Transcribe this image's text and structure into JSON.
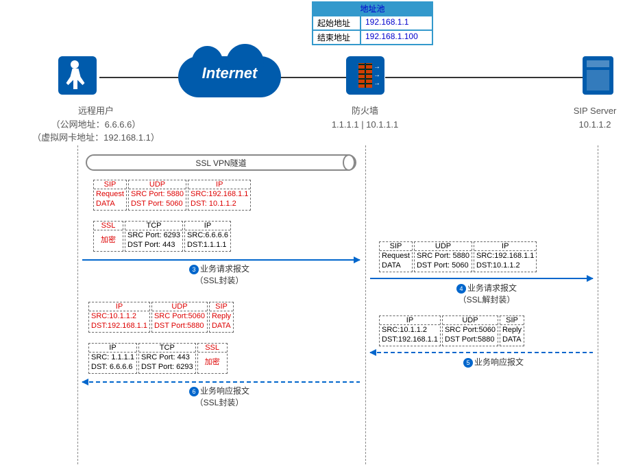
{
  "address_pool": {
    "title": "地址池",
    "start_label": "起始地址",
    "start_value": "192.168.1.1",
    "end_label": "结束地址",
    "end_value": "192.168.1.100"
  },
  "nodes": {
    "remote_user": {
      "label": "远程用户",
      "line2": "（公网地址：6.6.6.6）",
      "line3": "（虚拟网卡地址：192.168.1.1）"
    },
    "internet": {
      "label": "Internet"
    },
    "firewall": {
      "label": "防火墙",
      "addrs": "1.1.1.1 | 10.1.1.1"
    },
    "sip_server": {
      "label": "SIP Server",
      "addr": "10.1.1.2"
    }
  },
  "tunnel": "SSL VPN隧道",
  "packets": {
    "req_inner": {
      "sip_hdr": "SIP",
      "sip_l1": "Request",
      "sip_l2": "DATA",
      "udp_hdr": "UDP",
      "udp_l1": "SRC Port: 5880",
      "udp_l2": "DST Port: 5060",
      "ip_hdr": "IP",
      "ip_l1": "SRC:192.168.1.1",
      "ip_l2": "DST: 10.1.1.2"
    },
    "req_outer": {
      "ssl_hdr": "SSL",
      "ssl_l1": "加密",
      "tcp_hdr": "TCP",
      "tcp_l1": "SRC Port: 6293",
      "tcp_l2": "DST Port:  443",
      "ip_hdr": "IP",
      "ip_l1": "SRC:6.6.6.6",
      "ip_l2": "DST:1.1.1.1"
    },
    "resp_inner": {
      "ip_hdr": "IP",
      "ip_l1": "SRC:10.1.1.2",
      "ip_l2": "DST:192.168.1.1",
      "udp_hdr": "UDP",
      "udp_l1": "SRC Port:5060",
      "udp_l2": "DST Port:5880",
      "sip_hdr": "SIP",
      "sip_l1": "Reply",
      "sip_l2": "DATA"
    },
    "resp_outer": {
      "ip_hdr": "IP",
      "ip_l1": "SRC: 1.1.1.1",
      "ip_l2": "DST:  6.6.6.6",
      "tcp_hdr": "TCP",
      "tcp_l1": "SRC Port:  443",
      "tcp_l2": "DST Port: 6293",
      "ssl_hdr": "SSL",
      "ssl_l1": "加密"
    },
    "right_req": {
      "sip_hdr": "SIP",
      "sip_l1": "Request",
      "sip_l2": "DATA",
      "udp_hdr": "UDP",
      "udp_l1": "SRC Port: 5880",
      "udp_l2": "DST Port: 5060",
      "ip_hdr": "IP",
      "ip_l1": "SRC:192.168.1.1",
      "ip_l2": "DST:10.1.1.2"
    },
    "right_resp": {
      "ip_hdr": "IP",
      "ip_l1": "SRC:10.1.1.2",
      "ip_l2": "DST:192.168.1.1",
      "udp_hdr": "UDP",
      "udp_l1": "SRC Port:5060",
      "udp_l2": "DST Port:5880",
      "sip_hdr": "SIP",
      "sip_l1": "Reply",
      "sip_l2": "DATA"
    }
  },
  "labels": {
    "step3_num": "3",
    "step3_l1": "业务请求报文",
    "step3_l2": "（SSL封装）",
    "step4_num": "4",
    "step4_l1": "业务请求报文",
    "step4_l2": "（SSL解封装）",
    "step5_num": "5",
    "step5_l1": "业务响应报文",
    "step6_num": "6",
    "step6_l1": "业务响应报文",
    "step6_l2": "（SSL封装）"
  },
  "chart_data": {
    "type": "table",
    "description": "SSL VPN network extension packet flow diagram",
    "nodes": [
      {
        "name": "远程用户",
        "public_ip": "6.6.6.6",
        "virtual_ip": "192.168.1.1"
      },
      {
        "name": "Internet"
      },
      {
        "name": "防火墙",
        "outer_ip": "1.1.1.1",
        "inner_ip": "10.1.1.1"
      },
      {
        "name": "SIP Server",
        "ip": "10.1.1.2"
      }
    ],
    "address_pool": {
      "start": "192.168.1.1",
      "end": "192.168.1.100"
    },
    "flows": [
      {
        "step": 3,
        "dir": "user->firewall",
        "label": "业务请求报文（SSL封装）",
        "inner": {
          "proto": "SIP/UDP/IP",
          "src": "192.168.1.1",
          "dst": "10.1.1.2",
          "sport": 5880,
          "dport": 5060,
          "payload": "Request DATA"
        },
        "outer": {
          "proto": "SSL/TCP/IP",
          "src": "6.6.6.6",
          "dst": "1.1.1.1",
          "sport": 6293,
          "dport": 443,
          "payload": "加密"
        }
      },
      {
        "step": 4,
        "dir": "firewall->server",
        "label": "业务请求报文（SSL解封装）",
        "packet": {
          "proto": "SIP/UDP/IP",
          "src": "192.168.1.1",
          "dst": "10.1.1.2",
          "sport": 5880,
          "dport": 5060,
          "payload": "Request DATA"
        }
      },
      {
        "step": 5,
        "dir": "server->firewall",
        "label": "业务响应报文",
        "packet": {
          "proto": "IP/UDP/SIP",
          "src": "10.1.1.2",
          "dst": "192.168.1.1",
          "sport": 5060,
          "dport": 5880,
          "payload": "Reply DATA"
        }
      },
      {
        "step": 6,
        "dir": "firewall->user",
        "label": "业务响应报文（SSL封装）",
        "inner": {
          "proto": "IP/UDP/SIP",
          "src": "10.1.1.2",
          "dst": "192.168.1.1",
          "sport": 5060,
          "dport": 5880,
          "payload": "Reply DATA"
        },
        "outer": {
          "proto": "IP/TCP/SSL",
          "src": "1.1.1.1",
          "dst": "6.6.6.6",
          "sport": 443,
          "dport": 6293,
          "payload": "加密"
        }
      }
    ]
  }
}
